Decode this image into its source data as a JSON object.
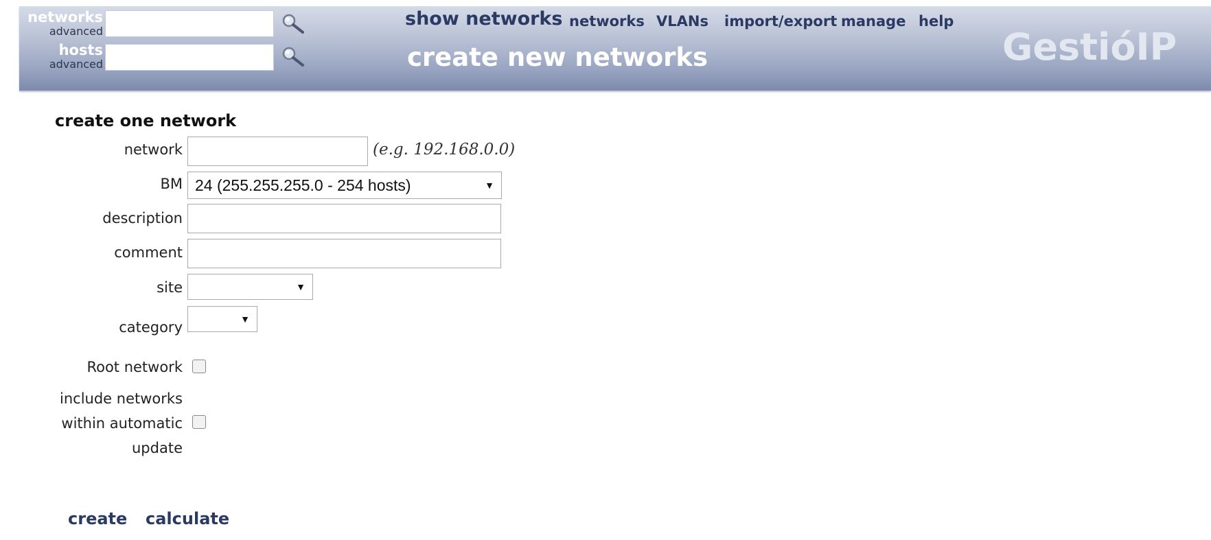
{
  "header": {
    "search": {
      "networks_label": "networks",
      "networks_advanced": "advanced",
      "networks_value": "",
      "hosts_label": "hosts",
      "hosts_advanced": "advanced",
      "hosts_value": "",
      "search_icon": "magnifier-icon"
    },
    "nav": {
      "show_networks": "show networks",
      "links": [
        "networks",
        "VLANs",
        "import/export",
        "manage",
        "help"
      ]
    },
    "page_title": "create new networks",
    "logo": "GestióIP"
  },
  "form": {
    "section_title": "create one network",
    "network_label": "network",
    "network_value": "",
    "network_hint": "(e.g. 192.168.0.0)",
    "bm_label": "BM",
    "bm_selected": "24 (255.255.255.0 - 254 hosts)",
    "description_label": "description",
    "description_value": "",
    "comment_label": "comment",
    "comment_value": "",
    "site_label": "site",
    "site_selected": "",
    "category_label": "category",
    "category_selected": "",
    "root_network_label": "Root network",
    "root_network_checked": false,
    "include_label_lines": [
      "include networks",
      "within automatic",
      "update"
    ],
    "include_checked": false
  },
  "actions": {
    "create": "create",
    "calculate": "calculate"
  },
  "colors": {
    "header_gradient_top": "#d6dbe7",
    "header_gradient_bottom": "#7d8aab",
    "link_color": "#2b3a63"
  }
}
